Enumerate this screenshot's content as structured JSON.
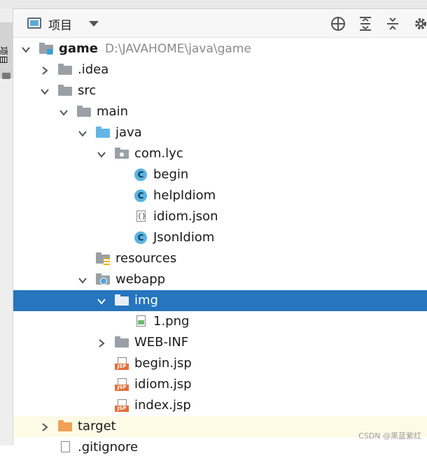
{
  "header": {
    "title": "项目",
    "icons": [
      "project-view-icon",
      "locate-icon",
      "expand-all-icon",
      "collapse-all-icon",
      "settings-icon"
    ]
  },
  "sidebar": {
    "tab_label": "项目"
  },
  "tree": [
    {
      "label": "game",
      "path": "D:\\JAVAHOME\\java\\game",
      "depth": 0,
      "expanded": true,
      "icon": "module-folder-icon",
      "bold": true
    },
    {
      "label": ".idea",
      "depth": 1,
      "expanded": false,
      "icon": "folder-icon"
    },
    {
      "label": "src",
      "depth": 1,
      "expanded": true,
      "icon": "folder-icon"
    },
    {
      "label": "main",
      "depth": 2,
      "expanded": true,
      "icon": "folder-icon"
    },
    {
      "label": "java",
      "depth": 3,
      "expanded": true,
      "icon": "source-folder-icon"
    },
    {
      "label": "com.lyc",
      "depth": 4,
      "expanded": true,
      "icon": "package-icon"
    },
    {
      "label": "begin",
      "depth": 5,
      "icon": "java-class-icon"
    },
    {
      "label": "helpIdiom",
      "depth": 5,
      "icon": "java-class-icon"
    },
    {
      "label": "idiom.json",
      "depth": 5,
      "icon": "json-file-icon"
    },
    {
      "label": "JsonIdiom",
      "depth": 5,
      "icon": "java-class-icon"
    },
    {
      "label": "resources",
      "depth": 3,
      "icon": "resources-folder-icon"
    },
    {
      "label": "webapp",
      "depth": 3,
      "expanded": true,
      "icon": "web-folder-icon"
    },
    {
      "label": "img",
      "depth": 4,
      "expanded": true,
      "icon": "folder-icon",
      "selected": true
    },
    {
      "label": "1.png",
      "depth": 5,
      "icon": "image-file-icon"
    },
    {
      "label": "WEB-INF",
      "depth": 4,
      "expanded": false,
      "icon": "folder-icon"
    },
    {
      "label": "begin.jsp",
      "depth": 4,
      "icon": "jsp-file-icon"
    },
    {
      "label": "idiom.jsp",
      "depth": 4,
      "icon": "jsp-file-icon"
    },
    {
      "label": "index.jsp",
      "depth": 4,
      "icon": "jsp-file-icon"
    },
    {
      "label": "target",
      "depth": 1,
      "expanded": false,
      "icon": "excluded-folder-icon",
      "excluded": true
    },
    {
      "label": ".gitignore",
      "depth": 1,
      "icon": "file-icon"
    }
  ],
  "icon_text": {
    "java_class": "C",
    "jsp": "JSP",
    "json": "{}"
  },
  "watermark": "CSDN @黑蓝紫红",
  "colors": {
    "selection": "#2675bf",
    "excluded_bg": "#fdfbe6"
  }
}
